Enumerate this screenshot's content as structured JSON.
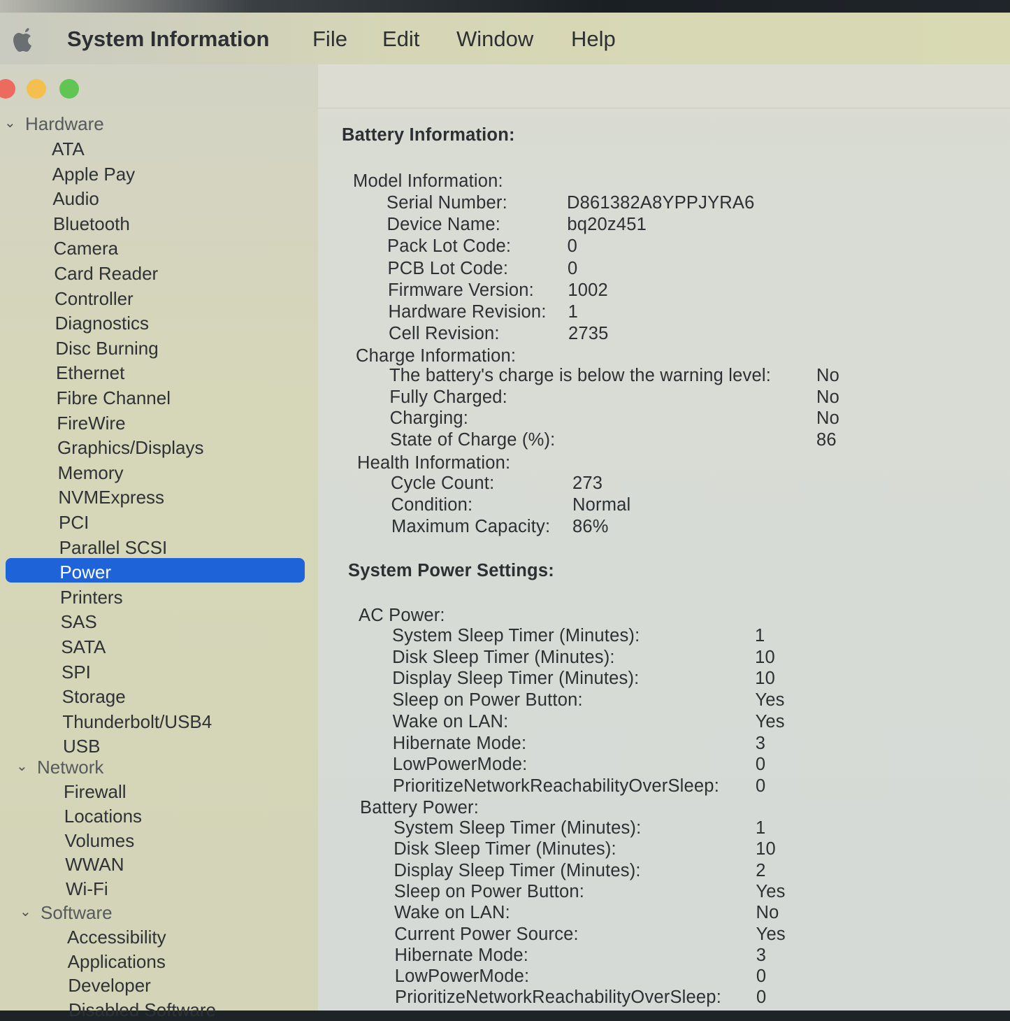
{
  "menubar": {
    "app": "System Information",
    "file": "File",
    "edit": "Edit",
    "window": "Window",
    "help": "Help"
  },
  "sidebar": {
    "hardware": "Hardware",
    "hardware_items": [
      "ATA",
      "Apple Pay",
      "Audio",
      "Bluetooth",
      "Camera",
      "Card Reader",
      "Controller",
      "Diagnostics",
      "Disc Burning",
      "Ethernet",
      "Fibre Channel",
      "FireWire",
      "Graphics/Displays",
      "Memory",
      "NVMExpress",
      "PCI",
      "Parallel SCSI",
      "Power",
      "Printers",
      "SAS",
      "SATA",
      "SPI",
      "Storage",
      "Thunderbolt/USB4",
      "USB"
    ],
    "network": "Network",
    "network_items": [
      "Firewall",
      "Locations",
      "Volumes",
      "WWAN",
      "Wi-Fi"
    ],
    "software": "Software",
    "software_items": [
      "Accessibility",
      "Applications",
      "Developer",
      "Disabled Software"
    ],
    "selected": "Power"
  },
  "battery": {
    "title": "Battery Information:",
    "model_header": "Model Information:",
    "model": [
      {
        "label": "Serial Number:",
        "value": "D861382A8YPPJYRA6"
      },
      {
        "label": "Device Name:",
        "value": "bq20z451"
      },
      {
        "label": "Pack Lot Code:",
        "value": "0"
      },
      {
        "label": "PCB Lot Code:",
        "value": "0"
      },
      {
        "label": "Firmware Version:",
        "value": "1002"
      },
      {
        "label": "Hardware Revision:",
        "value": "1"
      },
      {
        "label": "Cell Revision:",
        "value": "2735"
      }
    ],
    "charge_header": "Charge Information:",
    "charge": [
      {
        "label": "The battery's charge is below the warning level:",
        "value": "No"
      },
      {
        "label": "Fully Charged:",
        "value": "No"
      },
      {
        "label": "Charging:",
        "value": "No"
      },
      {
        "label": "State of Charge (%):",
        "value": "86"
      }
    ],
    "health_header": "Health Information:",
    "health": [
      {
        "label": "Cycle Count:",
        "value": "273"
      },
      {
        "label": "Condition:",
        "value": "Normal"
      },
      {
        "label": "Maximum Capacity:",
        "value": "86%"
      }
    ]
  },
  "power": {
    "title": "System Power Settings:",
    "ac_header": "AC Power:",
    "ac": [
      {
        "label": "System Sleep Timer (Minutes):",
        "value": "1"
      },
      {
        "label": "Disk Sleep Timer (Minutes):",
        "value": "10"
      },
      {
        "label": "Display Sleep Timer (Minutes):",
        "value": "10"
      },
      {
        "label": "Sleep on Power Button:",
        "value": "Yes"
      },
      {
        "label": "Wake on LAN:",
        "value": "Yes"
      },
      {
        "label": "Hibernate Mode:",
        "value": "3"
      },
      {
        "label": "LowPowerMode:",
        "value": "0"
      },
      {
        "label": "PrioritizeNetworkReachabilityOverSleep:",
        "value": "0"
      }
    ],
    "battery_header": "Battery Power:",
    "battery": [
      {
        "label": "System Sleep Timer (Minutes):",
        "value": "1"
      },
      {
        "label": "Disk Sleep Timer (Minutes):",
        "value": "10"
      },
      {
        "label": "Display Sleep Timer (Minutes):",
        "value": "2"
      },
      {
        "label": "Sleep on Power Button:",
        "value": "Yes"
      },
      {
        "label": "Wake on LAN:",
        "value": "No"
      },
      {
        "label": "Current Power Source:",
        "value": "Yes"
      },
      {
        "label": "Hibernate Mode:",
        "value": "3"
      },
      {
        "label": "LowPowerMode:",
        "value": "0"
      },
      {
        "label": "PrioritizeNetworkReachabilityOverSleep:",
        "value": "0"
      }
    ]
  },
  "colors": {
    "selection": "#1f63d9",
    "close": "#ec6a5e",
    "minimize": "#f4bf4f",
    "zoom": "#61c554"
  }
}
